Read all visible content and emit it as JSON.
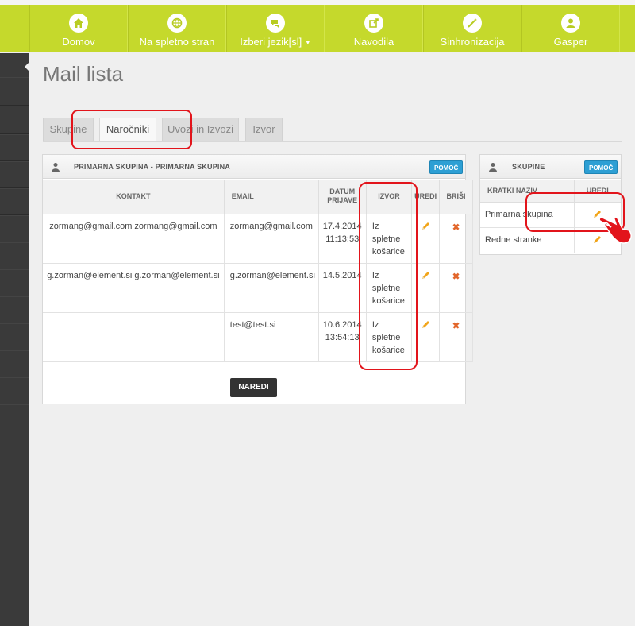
{
  "nav": [
    {
      "label": "Domov",
      "icon": "home-icon"
    },
    {
      "label": "Na spletno stran",
      "icon": "globe-icon"
    },
    {
      "label": "Izberi jezik[sl]",
      "icon": "chat-icon",
      "has_caret": true
    },
    {
      "label": "Navodila",
      "icon": "external-link-icon"
    },
    {
      "label": "Sinhronizacija",
      "icon": "magic-wand-icon"
    },
    {
      "label": "Gasper",
      "icon": "user-icon"
    }
  ],
  "page": {
    "title": "Mail lista"
  },
  "tabs": [
    {
      "label": "Skupine"
    },
    {
      "label": "Naročniki"
    },
    {
      "label": "Uvozi in Izvozi"
    },
    {
      "label": "Izvor"
    }
  ],
  "main_panel": {
    "title": "PRIMARNA SKUPINA - PRIMARNA SKUPINA",
    "help_label": "POMOČ",
    "columns": {
      "kontakt": "KONTAKT",
      "email": "EMAIL",
      "datum_1": "DATUM",
      "datum_2": "PRIJAVE",
      "izvor": "IZVOR",
      "uredi": "UREDI",
      "brisi": "BRIŠI"
    },
    "rows": [
      {
        "kontakt": "zormang@gmail.com zormang@gmail.com",
        "email": "zormang@gmail.com",
        "date": "17.4.2014",
        "time": "11:13:53",
        "izvor_1": "Iz",
        "izvor_2": "spletne",
        "izvor_3": "košarice"
      },
      {
        "kontakt": "g.zorman@element.si g.zorman@element.si",
        "email": "g.zorman@element.si",
        "date": "14.5.2014",
        "time": "",
        "izvor_1": "Iz",
        "izvor_2": "spletne",
        "izvor_3": "košarice"
      },
      {
        "kontakt": "",
        "email": "test@test.si",
        "date": "10.6.2014",
        "time": "13:54:13",
        "izvor_1": "Iz",
        "izvor_2": "spletne",
        "izvor_3": "košarice"
      }
    ],
    "naredi_label": "NAREDI"
  },
  "side_panel": {
    "title": "SKUPINE",
    "help_label": "POMOČ",
    "columns": {
      "naziv": "KRATKI NAZIV",
      "uredi": "UREDI"
    },
    "rows": [
      {
        "naziv": "Primarna skupina"
      },
      {
        "naziv": "Redne stranke"
      }
    ]
  },
  "colors": {
    "accent_green": "#c5d92c",
    "help_blue": "#2d9fd4",
    "annotation_red": "#e2141b",
    "delete_orange": "#e2662b"
  }
}
